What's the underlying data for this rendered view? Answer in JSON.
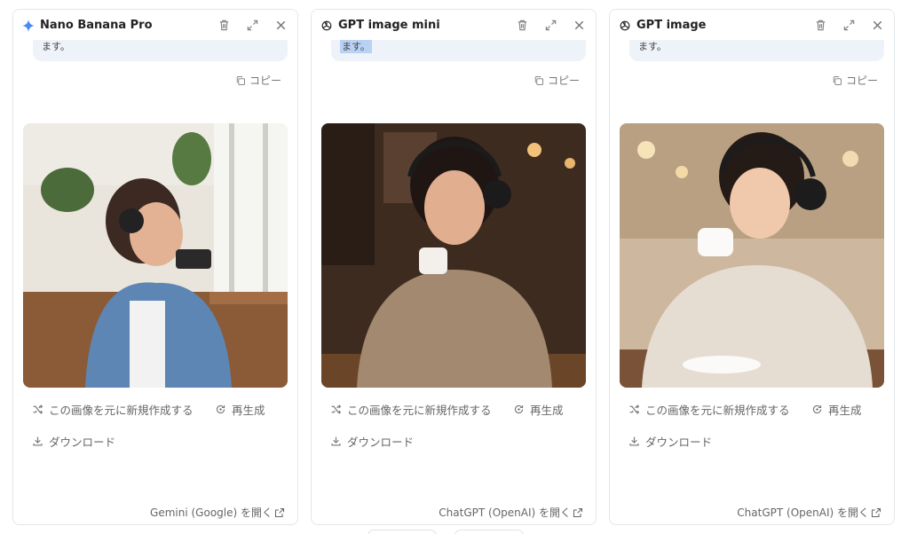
{
  "panels": [
    {
      "model_name": "Nano Banana Pro",
      "model_icon": "gemini-sparkle-icon",
      "bubble_text": "ます。",
      "copy_label": "コピー",
      "new_from_image_label": "この画像を元に新規作成する",
      "regenerate_label": "再生成",
      "download_label": "ダウンロード",
      "open_link_label": "Gemini (Google) を開く"
    },
    {
      "model_name": "GPT image mini",
      "model_icon": "openai-logo-icon",
      "bubble_text": "ます。",
      "copy_label": "コピー",
      "new_from_image_label": "この画像を元に新規作成する",
      "regenerate_label": "再生成",
      "download_label": "ダウンロード",
      "open_link_label": "ChatGPT (OpenAI) を開く"
    },
    {
      "model_name": "GPT image",
      "model_icon": "openai-logo-icon",
      "bubble_text": "ます。",
      "copy_label": "コピー",
      "new_from_image_label": "この画像を元に新規作成する",
      "regenerate_label": "再生成",
      "download_label": "ダウンロード",
      "open_link_label": "ChatGPT (OpenAI) を開く"
    }
  ],
  "icons": {
    "delete": "trash-icon",
    "expand": "expand-icon",
    "close": "close-icon",
    "copy": "copy-icon",
    "new_from_image": "shuffle-icon",
    "regenerate": "refresh-icon",
    "download": "download-icon",
    "external": "external-link-icon"
  },
  "colors": {
    "bubble_bg": "#eef3f9",
    "selection": "#b9d1f2",
    "panel_border": "#e2e6ea",
    "muted_text": "#666666",
    "gemini_accent": "#4a8af4"
  }
}
